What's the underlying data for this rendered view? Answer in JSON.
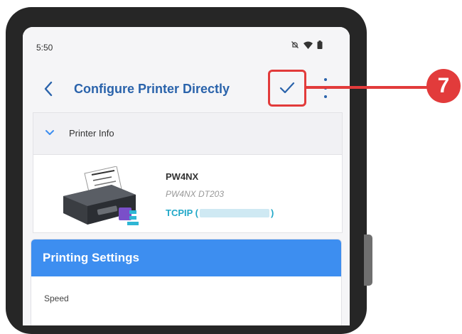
{
  "status_bar": {
    "time": "5:50",
    "icons": [
      "mute-icon",
      "wifi-icon",
      "battery-icon"
    ]
  },
  "app_bar": {
    "title": "Configure Printer Directly",
    "back_icon": "chevron-left-icon",
    "confirm_icon": "checkmark-icon",
    "more_icon": "more-vertical-icon"
  },
  "printer_info": {
    "header": "Printer Info",
    "name": "PW4NX",
    "model": "PW4NX DT203",
    "connection_prefix": "TCPIP (",
    "connection_suffix": ")"
  },
  "printing_settings": {
    "title": "Printing Settings",
    "first_field_label": "Speed"
  },
  "callout": {
    "number": "7"
  },
  "colors": {
    "accent": "#2a63ab",
    "header_blue": "#3d8ef0",
    "connection_cyan": "#22a8c8",
    "callout_red": "#e23b3b"
  }
}
